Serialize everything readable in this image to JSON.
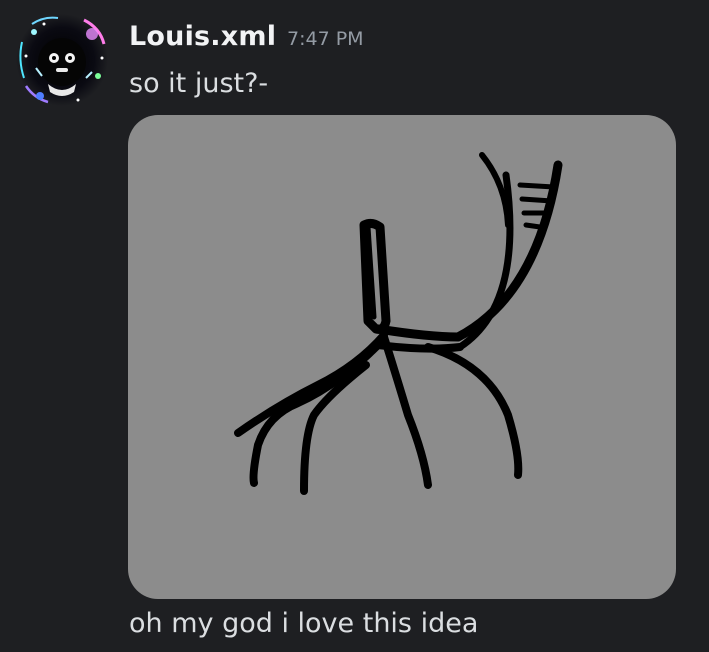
{
  "message": {
    "author": "Louis.xml",
    "timestamp": "7:47 PM",
    "lines": [
      "so it just?-",
      "oh my god i love this idea"
    ]
  },
  "colors": {
    "background": "#1e1f22",
    "username": "#f2f3f5",
    "timestamp": "#949ba4",
    "message_text": "#dbdee1",
    "attachment_bg": "#8c8c8c"
  },
  "icons": {
    "avatar": "avatar-icon"
  }
}
